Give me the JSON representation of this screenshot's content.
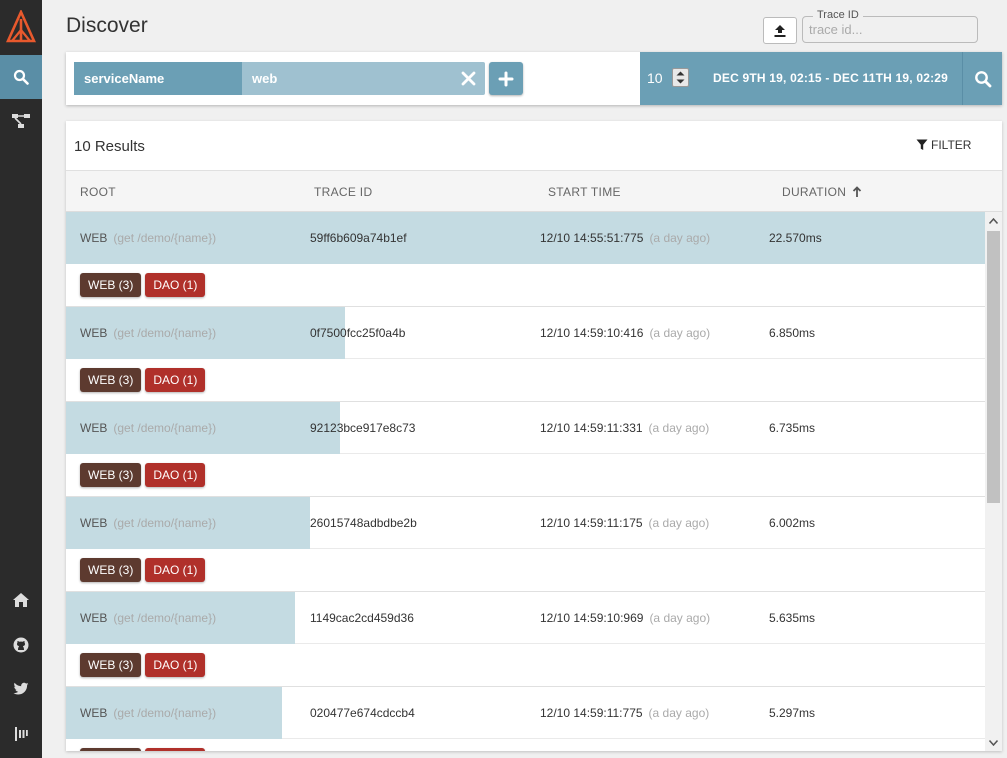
{
  "header": {
    "title": "Discover",
    "trace_id_label": "Trace ID",
    "trace_id_placeholder": "trace id...",
    "trace_id_value": ""
  },
  "sidebar": {
    "items": [
      {
        "name": "logo",
        "icon": "zipkin-logo-icon",
        "active": false
      },
      {
        "name": "discover",
        "icon": "search-icon",
        "active": true
      },
      {
        "name": "dependencies",
        "icon": "dependencies-icon",
        "active": false
      },
      {
        "name": "home",
        "icon": "home-icon",
        "active": false
      },
      {
        "name": "github",
        "icon": "github-icon",
        "active": false
      },
      {
        "name": "twitter",
        "icon": "twitter-icon",
        "active": false
      },
      {
        "name": "gitter",
        "icon": "gitter-icon",
        "active": false
      }
    ]
  },
  "search": {
    "criterion_key": "serviceName",
    "criterion_value": "web",
    "limit": "10",
    "date_range": "DEC 9TH 19, 02:15 - DEC 11TH 19, 02:29"
  },
  "results": {
    "count_label": "10 Results",
    "filter_label": "FILTER",
    "columns": [
      "ROOT",
      "TRACE ID",
      "START TIME",
      "DURATION"
    ],
    "sort_column": "DURATION",
    "sort_direction": "ascending",
    "traces": [
      {
        "root": "WEB",
        "path": "(get /demo/{name})",
        "trace_id": "59ff6b609a74b1ef",
        "start": "12/10 14:55:51:775",
        "ago": "(a day ago)",
        "duration": "22.570ms",
        "relative_duration": 1.0,
        "badges": [
          {
            "label": "WEB (3)",
            "color": "#5d3a2f"
          },
          {
            "label": "DAO (1)",
            "color": "#b0302a"
          }
        ]
      },
      {
        "root": "WEB",
        "path": "(get /demo/{name})",
        "trace_id": "0f7500fcc25f0a4b",
        "start": "12/10 14:59:10:416",
        "ago": "(a day ago)",
        "duration": "6.850ms",
        "relative_duration": 0.3035,
        "badges": [
          {
            "label": "WEB (3)",
            "color": "#5d3a2f"
          },
          {
            "label": "DAO (1)",
            "color": "#b0302a"
          }
        ]
      },
      {
        "root": "WEB",
        "path": "(get /demo/{name})",
        "trace_id": "92123bce917e8c73",
        "start": "12/10 14:59:11:331",
        "ago": "(a day ago)",
        "duration": "6.735ms",
        "relative_duration": 0.2984,
        "badges": [
          {
            "label": "WEB (3)",
            "color": "#5d3a2f"
          },
          {
            "label": "DAO (1)",
            "color": "#b0302a"
          }
        ]
      },
      {
        "root": "WEB",
        "path": "(get /demo/{name})",
        "trace_id": "26015748adbdbe2b",
        "start": "12/10 14:59:11:175",
        "ago": "(a day ago)",
        "duration": "6.002ms",
        "relative_duration": 0.2659,
        "badges": [
          {
            "label": "WEB (3)",
            "color": "#5d3a2f"
          },
          {
            "label": "DAO (1)",
            "color": "#b0302a"
          }
        ]
      },
      {
        "root": "WEB",
        "path": "(get /demo/{name})",
        "trace_id": "1149cac2cd459d36",
        "start": "12/10 14:59:10:969",
        "ago": "(a day ago)",
        "duration": "5.635ms",
        "relative_duration": 0.2497,
        "badges": [
          {
            "label": "WEB (3)",
            "color": "#5d3a2f"
          },
          {
            "label": "DAO (1)",
            "color": "#b0302a"
          }
        ]
      },
      {
        "root": "WEB",
        "path": "(get /demo/{name})",
        "trace_id": "020477e674cdccb4",
        "start": "12/10 14:59:11:775",
        "ago": "(a day ago)",
        "duration": "5.297ms",
        "relative_duration": 0.2347,
        "badges": [
          {
            "label": "WEB (3)",
            "color": "#5d3a2f"
          },
          {
            "label": "DAO (1)",
            "color": "#b0302a"
          }
        ]
      }
    ]
  },
  "colors": {
    "accent": "#6b9fb5",
    "sidebar_bg": "#2b2b2b",
    "duration_bar": "#c4dbe2"
  }
}
